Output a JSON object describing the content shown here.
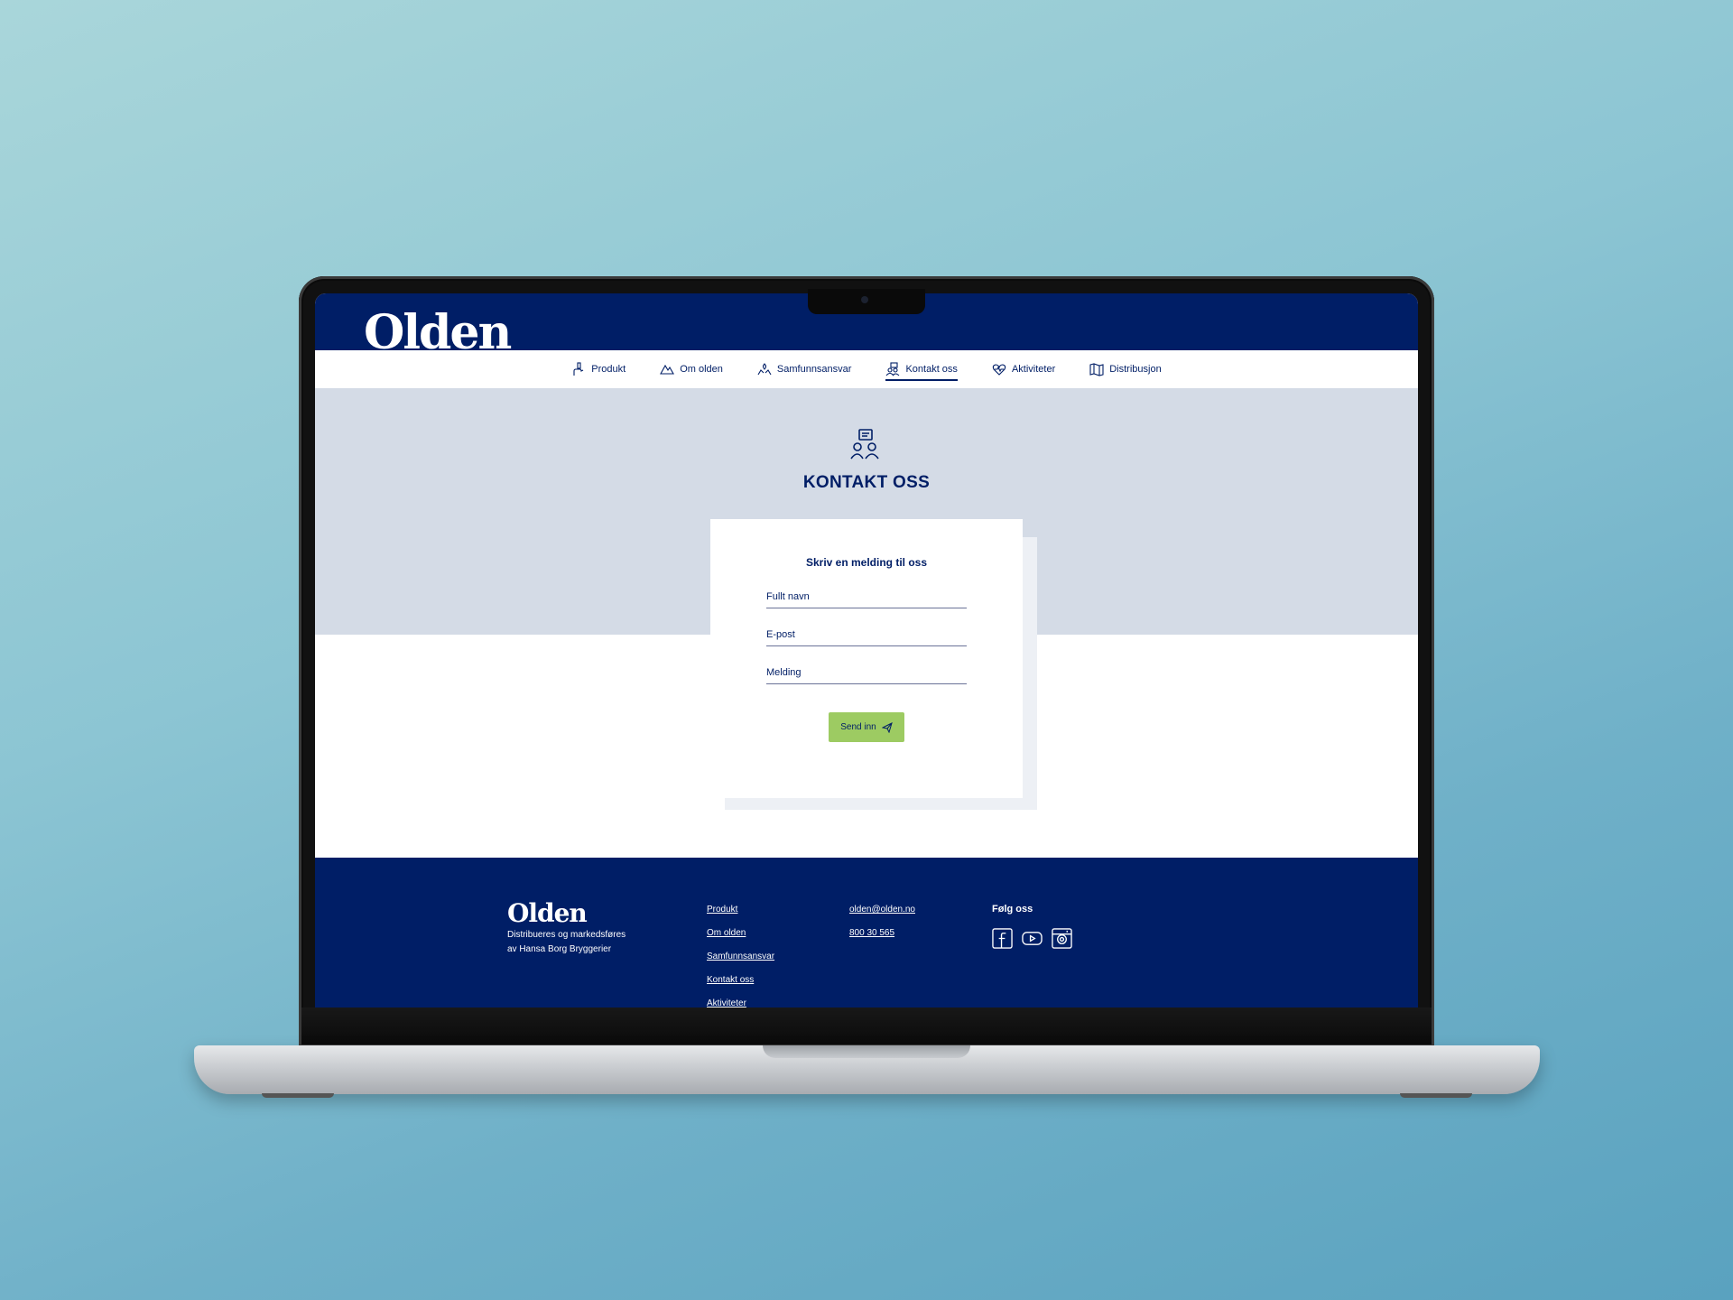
{
  "site": {
    "logo": "Olden"
  },
  "nav": {
    "items": [
      {
        "label": "Produkt",
        "icon": "hand-bottle-icon"
      },
      {
        "label": "Om olden",
        "icon": "mountain-icon"
      },
      {
        "label": "Samfunnsansvar",
        "icon": "hands-leaf-icon"
      },
      {
        "label": "Kontakt oss",
        "icon": "contact-icon",
        "active": true
      },
      {
        "label": "Aktiviteter",
        "icon": "heart-pulse-icon"
      },
      {
        "label": "Distribusjon",
        "icon": "map-icon"
      }
    ]
  },
  "hero": {
    "title": "KONTAKT OSS",
    "icon": "contact-people-icon"
  },
  "form": {
    "title": "Skriv en melding til oss",
    "fields": {
      "name": "Fullt navn",
      "email": "E-post",
      "message": "Melding"
    },
    "submit_label": "Send inn",
    "submit_icon": "paper-plane-icon"
  },
  "footer": {
    "logo": "Olden",
    "tagline_line1": "Distribueres og markedsføres",
    "tagline_line2": "av Hansa Borg Bryggerier",
    "links": [
      "Produkt",
      "Om olden",
      "Samfunnsansvar",
      "Kontakt oss",
      "Aktiviteter"
    ],
    "email": "olden@olden.no",
    "phone": "800 30 565",
    "follow_title": "Følg oss",
    "socials": [
      "facebook-icon",
      "youtube-icon",
      "instagram-icon"
    ]
  },
  "colors": {
    "brand_navy": "#001e66",
    "hero_bg": "#d4dbe6",
    "button_green": "#9dcb62",
    "backdrop": "#7fbccf"
  }
}
